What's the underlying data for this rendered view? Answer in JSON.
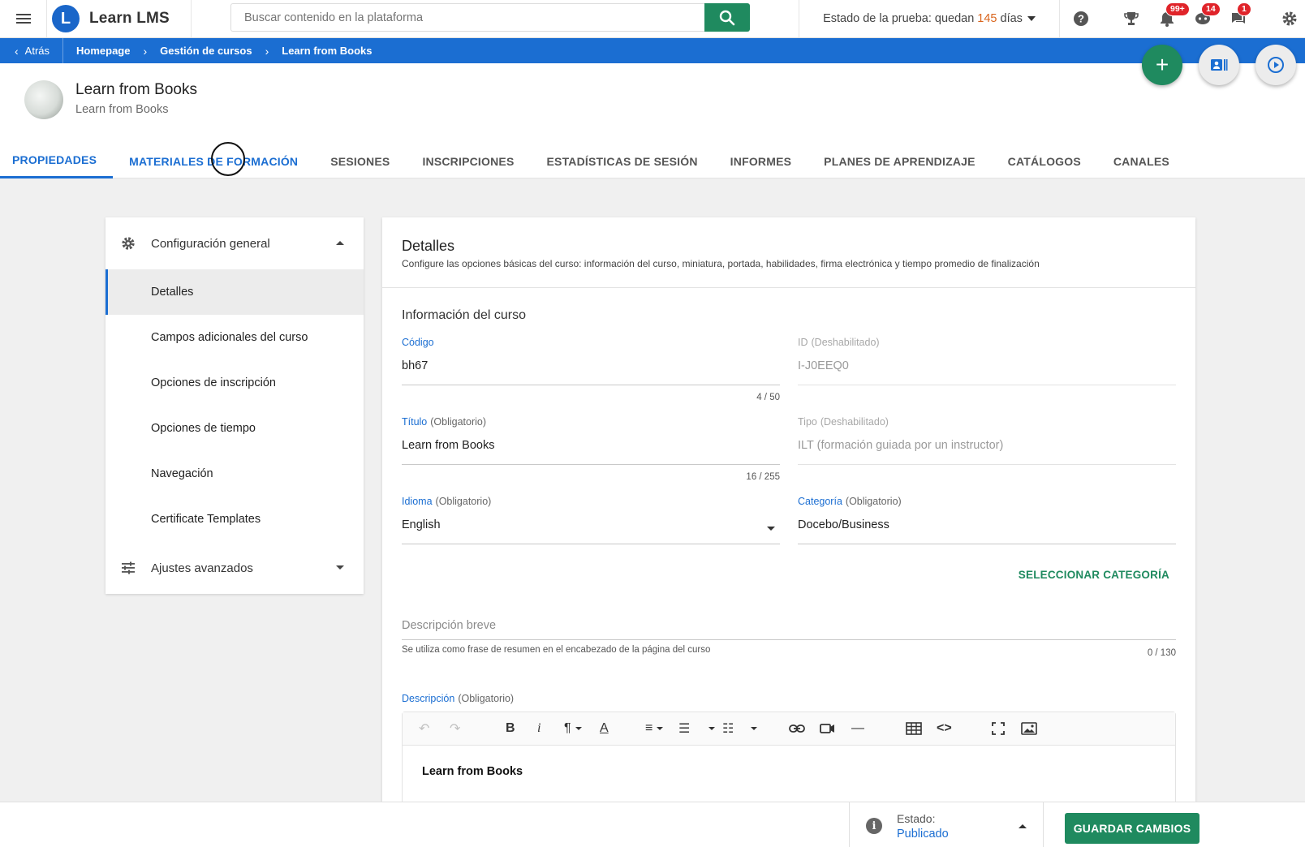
{
  "app": {
    "name": "Learn LMS",
    "logo_letter": "L"
  },
  "search": {
    "placeholder": "Buscar contenido en la plataforma"
  },
  "trial": {
    "prefix": "Estado de la prueba: quedan",
    "days": "145",
    "suffix": "días"
  },
  "notifications": {
    "bell_badge": "99+",
    "chat_badge": "14",
    "messages_badge": "1"
  },
  "breadcrumb": {
    "back": "Atrás",
    "items": [
      "Homepage",
      "Gestión de cursos",
      "Learn from Books"
    ]
  },
  "course": {
    "title": "Learn from Books",
    "subtitle": "Learn from Books"
  },
  "tabs": [
    "PROPIEDADES",
    "MATERIALES DE FORMACIÓN",
    "SESIONES",
    "INSCRIPCIONES",
    "ESTADÍSTICAS DE SESIÓN",
    "INFORMES",
    "PLANES DE APRENDIZAJE",
    "CATÁLOGOS",
    "CANALES"
  ],
  "leftnav": {
    "group1": "Configuración general",
    "items": [
      "Detalles",
      "Campos adicionales del curso",
      "Opciones de inscripción",
      "Opciones de tiempo",
      "Navegación",
      "Certificate Templates"
    ],
    "group2": "Ajustes avanzados"
  },
  "details": {
    "title": "Detalles",
    "description": "Configure las opciones básicas del curso: información del curso, miniatura, portada, habilidades, firma electrónica y tiempo promedio de finalización",
    "section": "Información del curso",
    "codigo": {
      "label": "Código",
      "value": "bh67",
      "count": "4 / 50"
    },
    "id": {
      "label": "ID",
      "note": "(Deshabilitado)",
      "value": "I-J0EEQ0"
    },
    "titulo": {
      "label": "Título",
      "note": "(Obligatorio)",
      "value": "Learn from Books",
      "count": "16 / 255"
    },
    "tipo": {
      "label": "Tipo",
      "note": "(Deshabilitado)",
      "value": "ILT (formación guiada por un instructor)"
    },
    "idioma": {
      "label": "Idioma",
      "note": "(Obligatorio)",
      "value": "English"
    },
    "categoria": {
      "label": "Categoría",
      "note": "(Obligatorio)",
      "value": "Docebo/Business"
    },
    "select_category": "SELECCIONAR CATEGORÍA",
    "short_desc": {
      "placeholder": "Descripción breve",
      "hint": "Se utiliza como frase de resumen en el encabezado de la página del curso",
      "count": "0 / 130"
    },
    "descripcion": {
      "label": "Descripción",
      "note": "(Obligatorio)",
      "content": "Learn from Books"
    }
  },
  "footer": {
    "status_label": "Estado:",
    "status_value": "Publicado",
    "save": "GUARDAR CAMBIOS"
  },
  "colors": {
    "primary": "#1b6ed2",
    "accent": "#1f8a5f",
    "badge": "#e0242a",
    "trial_days": "#d9651d"
  }
}
